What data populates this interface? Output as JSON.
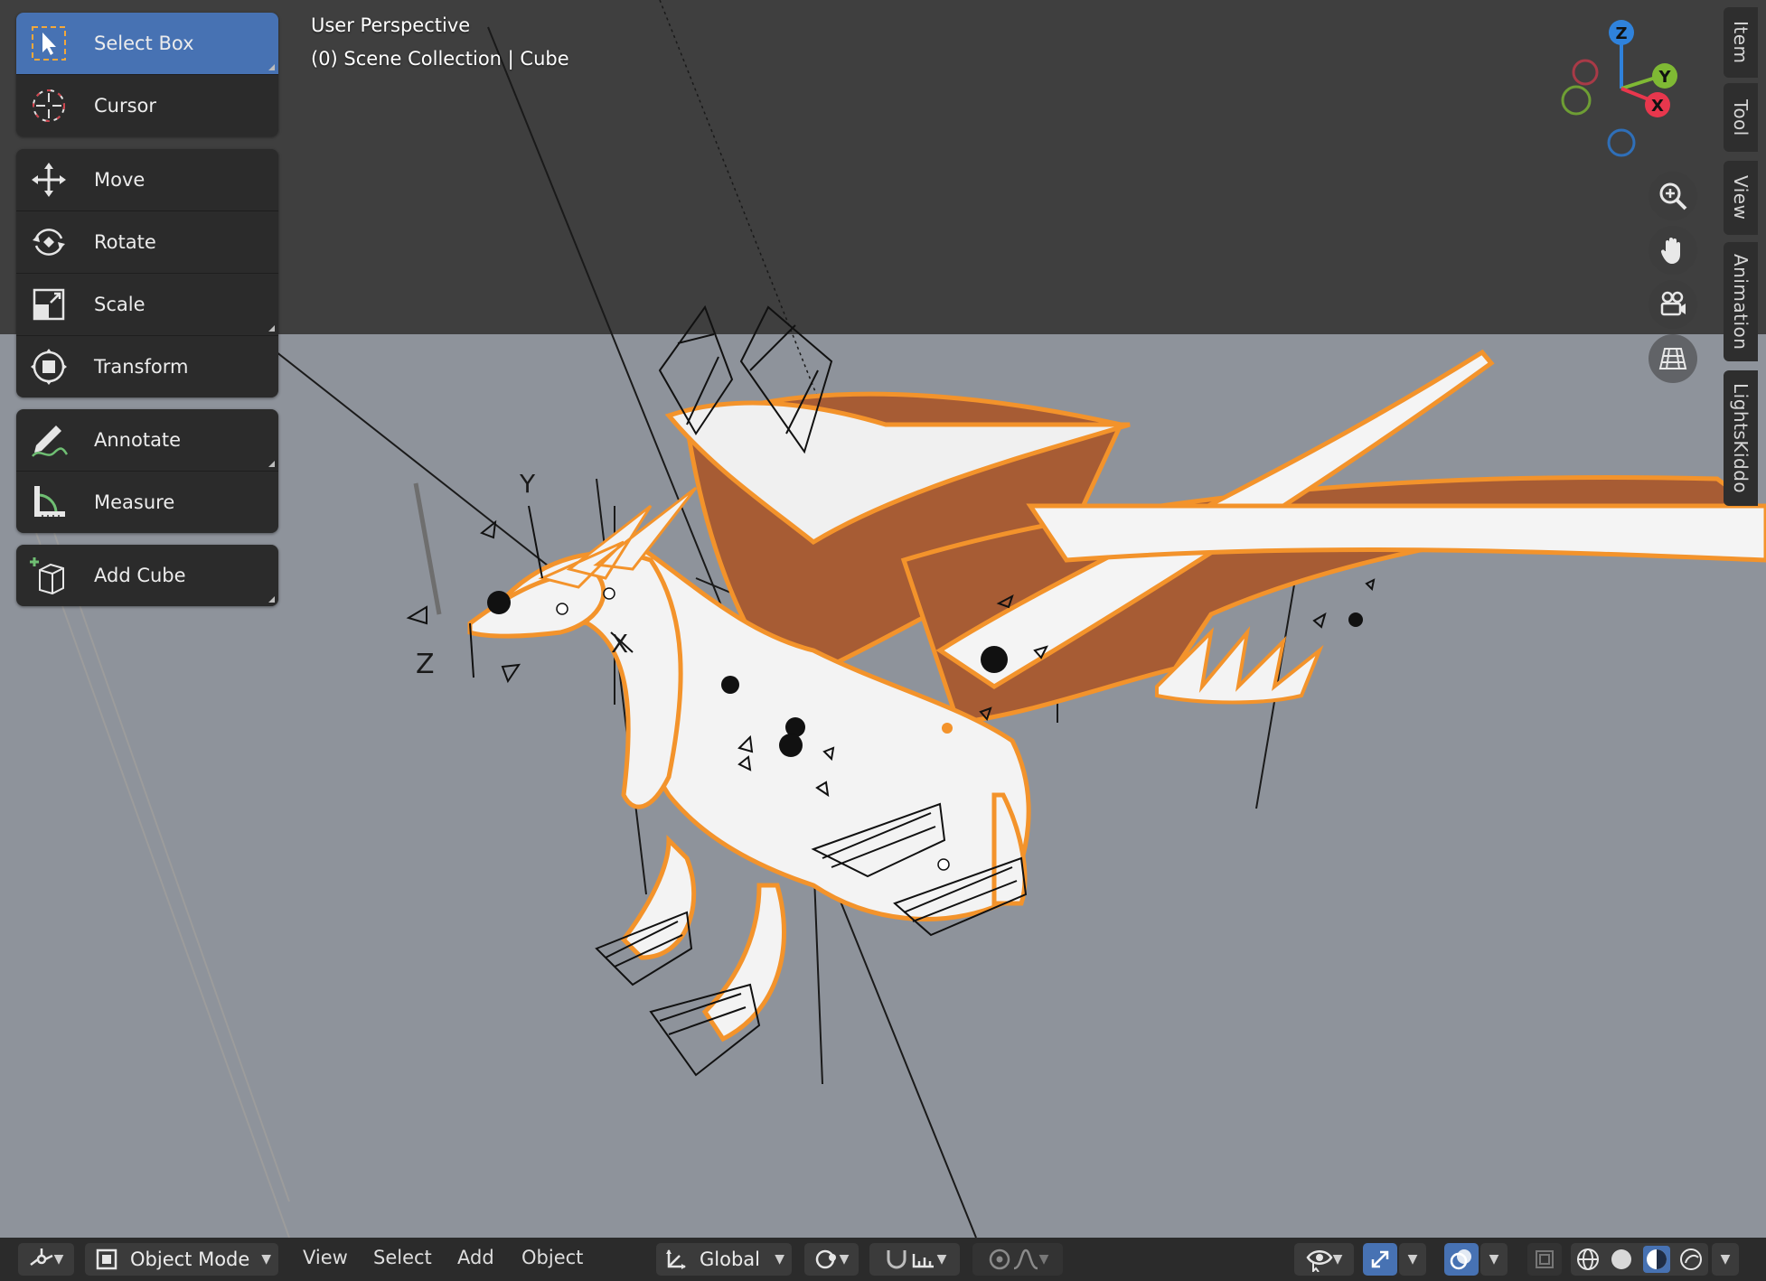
{
  "overlay": {
    "perspective": "User Perspective",
    "collection": "(0) Scene Collection | Cube"
  },
  "toolbar": {
    "groups": [
      [
        {
          "label": "Select Box",
          "icon": "select-box-icon",
          "active": true
        },
        {
          "label": "Cursor",
          "icon": "cursor-icon"
        }
      ],
      [
        {
          "label": "Move",
          "icon": "move-icon"
        },
        {
          "label": "Rotate",
          "icon": "rotate-icon"
        },
        {
          "label": "Scale",
          "icon": "scale-icon"
        },
        {
          "label": "Transform",
          "icon": "transform-icon"
        }
      ],
      [
        {
          "label": "Annotate",
          "icon": "annotate-icon"
        },
        {
          "label": "Measure",
          "icon": "measure-icon"
        }
      ],
      [
        {
          "label": "Add Cube",
          "icon": "add-cube-icon"
        }
      ]
    ]
  },
  "gizmo": {
    "x": "X",
    "y": "Y",
    "z": "Z"
  },
  "scene_labels": {
    "y": "Y",
    "z": "Z",
    "x": "X"
  },
  "side_tabs": [
    "Item",
    "Tool",
    "View",
    "Animation",
    "LightsKiddo"
  ],
  "header": {
    "mode": "Object Mode",
    "menus": [
      "View",
      "Select",
      "Add",
      "Object"
    ],
    "transform_orientation": "Global"
  },
  "colors": {
    "accent": "#4772b3",
    "selection_outline": "#f3932b",
    "wing_membrane": "#a75c34",
    "axis_x": "#e8374d",
    "axis_y": "#7fb934",
    "axis_z": "#2f82dc"
  }
}
